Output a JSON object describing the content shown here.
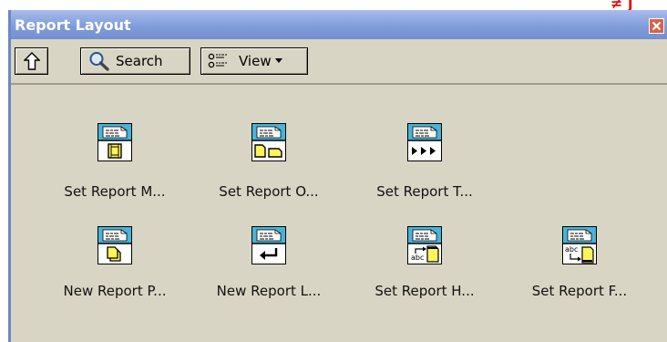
{
  "window": {
    "title": "Report Layout",
    "corner_glyphs": "≠ ʃ"
  },
  "toolbar": {
    "up_label": "",
    "search_label": "Search",
    "view_label": "View"
  },
  "icons": [
    {
      "label": "Set Report M...",
      "icon": "report-margins-icon"
    },
    {
      "label": "Set Report O...",
      "icon": "report-orientation-icon"
    },
    {
      "label": "Set Report T...",
      "icon": "report-tabs-icon"
    },
    {
      "label": "New Report P...",
      "icon": "new-page-icon"
    },
    {
      "label": "New Report L...",
      "icon": "new-line-icon"
    },
    {
      "label": "Set Report H...",
      "icon": "report-header-icon"
    },
    {
      "label": "Set Report F...",
      "icon": "report-footer-icon"
    }
  ],
  "colors": {
    "title_bar": "#7e9ad8",
    "palette_bg": "#d9d5c4",
    "icon_header": "#48b4d8",
    "icon_yellow": "#fff45a"
  }
}
